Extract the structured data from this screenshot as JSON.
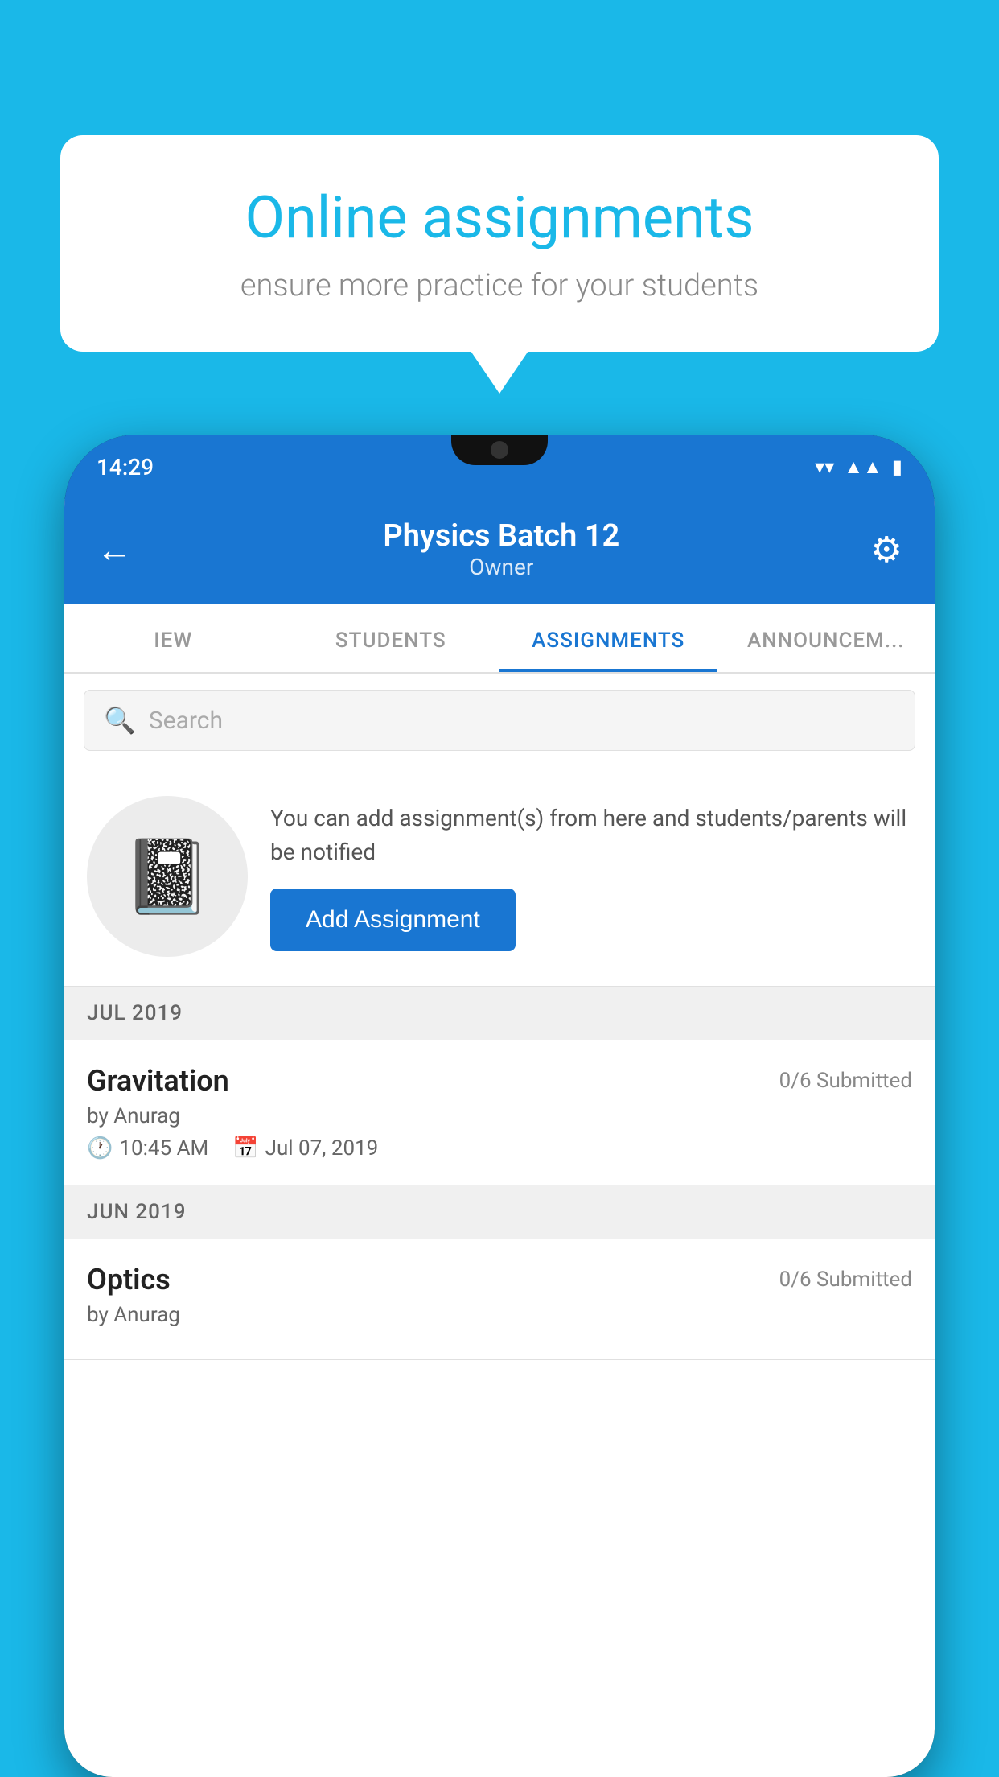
{
  "background_color": "#1ab8e8",
  "speech_bubble": {
    "title": "Online assignments",
    "subtitle": "ensure more practice for your students"
  },
  "phone": {
    "status_bar": {
      "time": "14:29",
      "icons": [
        "wifi",
        "signal",
        "battery"
      ]
    },
    "header": {
      "back_label": "←",
      "title": "Physics Batch 12",
      "subtitle": "Owner",
      "gear_label": "⚙"
    },
    "tabs": [
      {
        "label": "IEW",
        "active": false
      },
      {
        "label": "STUDENTS",
        "active": false
      },
      {
        "label": "ASSIGNMENTS",
        "active": true
      },
      {
        "label": "ANNOUNCEM...",
        "active": false
      }
    ],
    "search": {
      "placeholder": "Search"
    },
    "promo": {
      "text": "You can add assignment(s) from here and students/parents will be notified",
      "button_label": "Add Assignment"
    },
    "sections": [
      {
        "header": "JUL 2019",
        "assignments": [
          {
            "name": "Gravitation",
            "submitted": "0/6 Submitted",
            "author": "by Anurag",
            "time": "10:45 AM",
            "date": "Jul 07, 2019"
          }
        ]
      },
      {
        "header": "JUN 2019",
        "assignments": [
          {
            "name": "Optics",
            "submitted": "0/6 Submitted",
            "author": "by Anurag",
            "time": "",
            "date": ""
          }
        ]
      }
    ]
  }
}
